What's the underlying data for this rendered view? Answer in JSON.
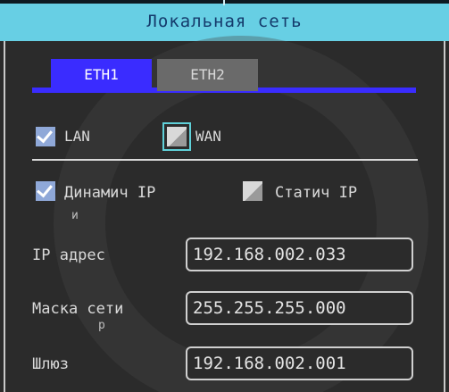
{
  "title": "Локальная сеть",
  "tabs": [
    {
      "label": "ETH1",
      "active": true
    },
    {
      "label": "ETH2",
      "active": false
    }
  ],
  "connection_type": {
    "lan": {
      "label": "LAN",
      "checked": true
    },
    "wan": {
      "label": "WAN",
      "checked": false
    }
  },
  "ip_mode": {
    "dynamic": {
      "label": "Динамич IP",
      "label_wrap": "и",
      "checked": true
    },
    "static": {
      "label": "Статич IP",
      "checked": false
    }
  },
  "fields": {
    "ip_address": {
      "label": "IP адрес",
      "value": "192.168.002.033"
    },
    "subnet_mask": {
      "label": "Маска сети",
      "label_wrap": "р",
      "value": "255.255.255.000"
    },
    "gateway": {
      "label": "Шлюз",
      "value": "192.168.002.001"
    }
  },
  "colors": {
    "title_bar": "#67cfe4",
    "active_tab": "#3a2cff",
    "inactive_tab": "#6a6a6a",
    "background": "#2b2b2b"
  }
}
